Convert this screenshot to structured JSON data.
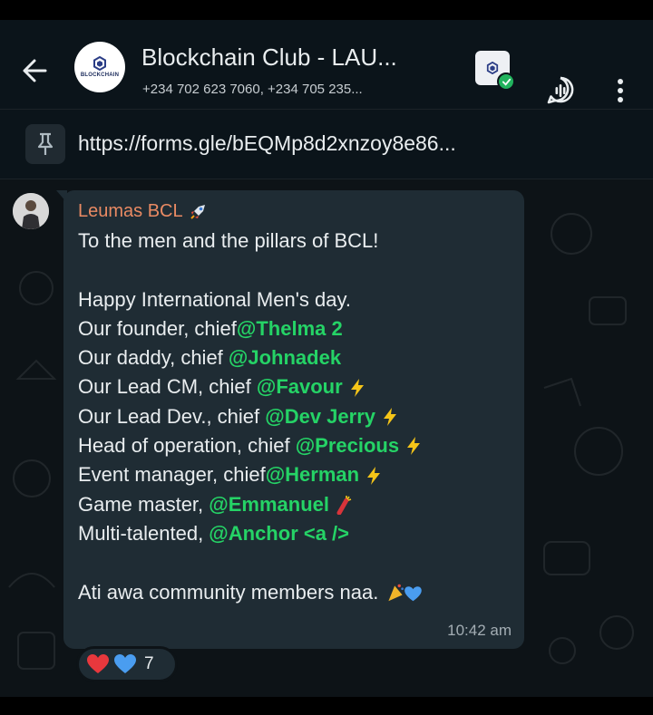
{
  "header": {
    "title": "Blockchain Club - LAU...",
    "subtitle": "+234 702 623 7060, +234 705 235...",
    "avatar_text": "BLOCKCHAIN"
  },
  "pinned": {
    "link": "https://forms.gle/bEQMp8d2xnzoy8e86..."
  },
  "message": {
    "sender": "Leumas BCL",
    "lines": [
      {
        "text": "To the men and the pillars of BCL!",
        "mention": "",
        "emoji": ""
      },
      {
        "text": "",
        "mention": "",
        "emoji": ""
      },
      {
        "text": "Happy International Men's day.",
        "mention": "",
        "emoji": ""
      },
      {
        "text": "Our founder, chief",
        "mention": "@Thelma 2",
        "emoji": ""
      },
      {
        "text": "Our daddy, chief ",
        "mention": "@Johnadek",
        "emoji": ""
      },
      {
        "text": "Our Lead CM, chief ",
        "mention": "@Favour",
        "emoji": "lightning"
      },
      {
        "text": "Our Lead Dev., chief ",
        "mention": "@Dev Jerry",
        "emoji": "lightning"
      },
      {
        "text": "Head of operation, chief ",
        "mention": "@Precious",
        "emoji": "lightning"
      },
      {
        "text": "Event manager, chief",
        "mention": "@Herman",
        "emoji": "lightning"
      },
      {
        "text": "Game master, ",
        "mention": "@Emmanuel",
        "emoji": "firecracker"
      },
      {
        "text": "Multi-talented, ",
        "mention": "@Anchor <a />",
        "emoji": ""
      },
      {
        "text": "",
        "mention": "",
        "emoji": ""
      },
      {
        "text": "Ati awa community members naa.",
        "mention": "",
        "emoji": "party-heart"
      }
    ],
    "time": "10:42 am"
  },
  "reactions": {
    "emojis": [
      "red-heart",
      "blue-heart"
    ],
    "count": "7"
  },
  "colors": {
    "mention": "#25d366",
    "sender": "#e98a63",
    "bubble": "#1f2c34",
    "background": "#0b141a"
  }
}
